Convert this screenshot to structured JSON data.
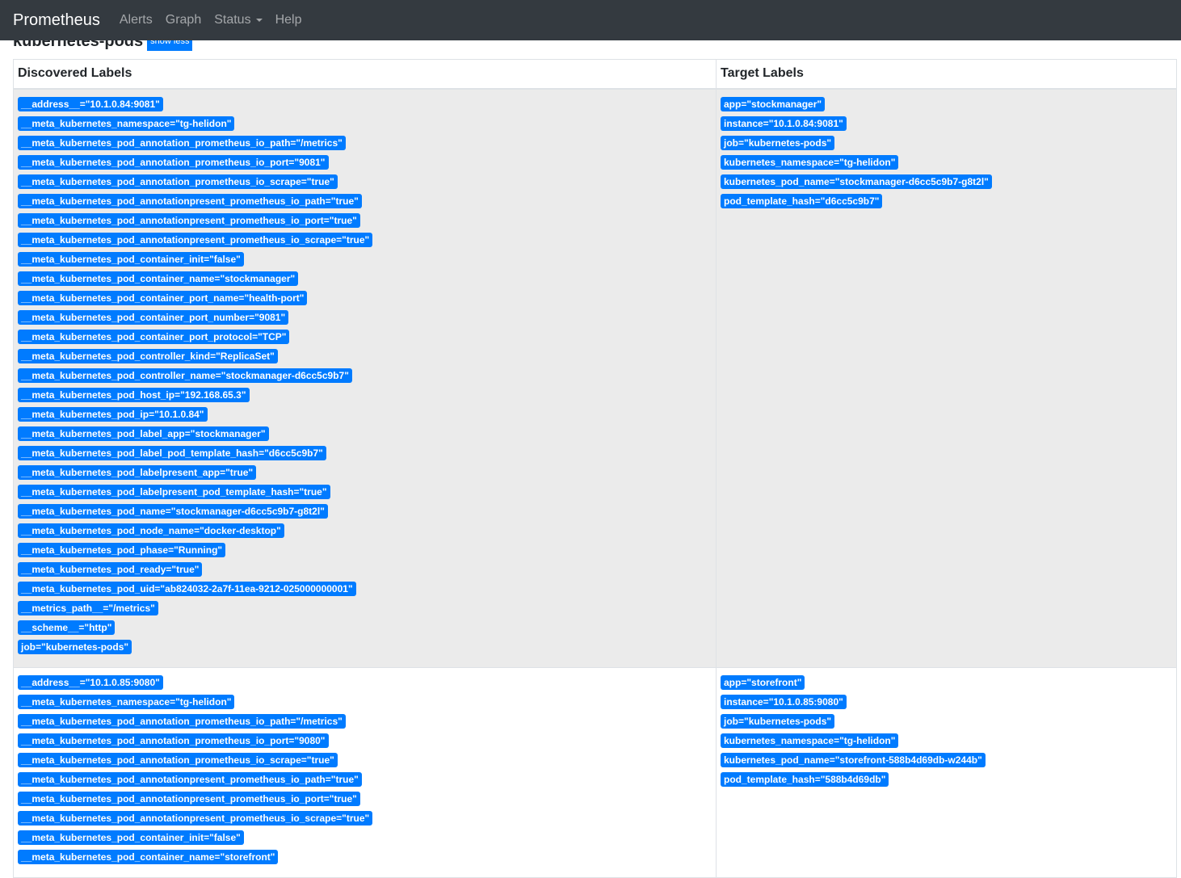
{
  "navbar": {
    "brand": "Prometheus",
    "links": [
      "Alerts",
      "Graph",
      "Status",
      "Help"
    ]
  },
  "job": {
    "title": "kubernetes-pods",
    "toggle_label": "show less"
  },
  "table": {
    "headers": [
      "Discovered Labels",
      "Target Labels"
    ],
    "rows": [
      {
        "discovered": [
          "__address__=\"10.1.0.84:9081\"",
          "__meta_kubernetes_namespace=\"tg-helidon\"",
          "__meta_kubernetes_pod_annotation_prometheus_io_path=\"/metrics\"",
          "__meta_kubernetes_pod_annotation_prometheus_io_port=\"9081\"",
          "__meta_kubernetes_pod_annotation_prometheus_io_scrape=\"true\"",
          "__meta_kubernetes_pod_annotationpresent_prometheus_io_path=\"true\"",
          "__meta_kubernetes_pod_annotationpresent_prometheus_io_port=\"true\"",
          "__meta_kubernetes_pod_annotationpresent_prometheus_io_scrape=\"true\"",
          "__meta_kubernetes_pod_container_init=\"false\"",
          "__meta_kubernetes_pod_container_name=\"stockmanager\"",
          "__meta_kubernetes_pod_container_port_name=\"health-port\"",
          "__meta_kubernetes_pod_container_port_number=\"9081\"",
          "__meta_kubernetes_pod_container_port_protocol=\"TCP\"",
          "__meta_kubernetes_pod_controller_kind=\"ReplicaSet\"",
          "__meta_kubernetes_pod_controller_name=\"stockmanager-d6cc5c9b7\"",
          "__meta_kubernetes_pod_host_ip=\"192.168.65.3\"",
          "__meta_kubernetes_pod_ip=\"10.1.0.84\"",
          "__meta_kubernetes_pod_label_app=\"stockmanager\"",
          "__meta_kubernetes_pod_label_pod_template_hash=\"d6cc5c9b7\"",
          "__meta_kubernetes_pod_labelpresent_app=\"true\"",
          "__meta_kubernetes_pod_labelpresent_pod_template_hash=\"true\"",
          "__meta_kubernetes_pod_name=\"stockmanager-d6cc5c9b7-g8t2l\"",
          "__meta_kubernetes_pod_node_name=\"docker-desktop\"",
          "__meta_kubernetes_pod_phase=\"Running\"",
          "__meta_kubernetes_pod_ready=\"true\"",
          "__meta_kubernetes_pod_uid=\"ab824032-2a7f-11ea-9212-025000000001\"",
          "__metrics_path__=\"/metrics\"",
          "__scheme__=\"http\"",
          "job=\"kubernetes-pods\""
        ],
        "target": [
          "app=\"stockmanager\"",
          "instance=\"10.1.0.84:9081\"",
          "job=\"kubernetes-pods\"",
          "kubernetes_namespace=\"tg-helidon\"",
          "kubernetes_pod_name=\"stockmanager-d6cc5c9b7-g8t2l\"",
          "pod_template_hash=\"d6cc5c9b7\""
        ]
      },
      {
        "discovered": [
          "__address__=\"10.1.0.85:9080\"",
          "__meta_kubernetes_namespace=\"tg-helidon\"",
          "__meta_kubernetes_pod_annotation_prometheus_io_path=\"/metrics\"",
          "__meta_kubernetes_pod_annotation_prometheus_io_port=\"9080\"",
          "__meta_kubernetes_pod_annotation_prometheus_io_scrape=\"true\"",
          "__meta_kubernetes_pod_annotationpresent_prometheus_io_path=\"true\"",
          "__meta_kubernetes_pod_annotationpresent_prometheus_io_port=\"true\"",
          "__meta_kubernetes_pod_annotationpresent_prometheus_io_scrape=\"true\"",
          "__meta_kubernetes_pod_container_init=\"false\"",
          "__meta_kubernetes_pod_container_name=\"storefront\""
        ],
        "target": [
          "app=\"storefront\"",
          "instance=\"10.1.0.85:9080\"",
          "job=\"kubernetes-pods\"",
          "kubernetes_namespace=\"tg-helidon\"",
          "kubernetes_pod_name=\"storefront-588b4d69db-w244b\"",
          "pod_template_hash=\"588b4d69db\""
        ]
      }
    ]
  }
}
